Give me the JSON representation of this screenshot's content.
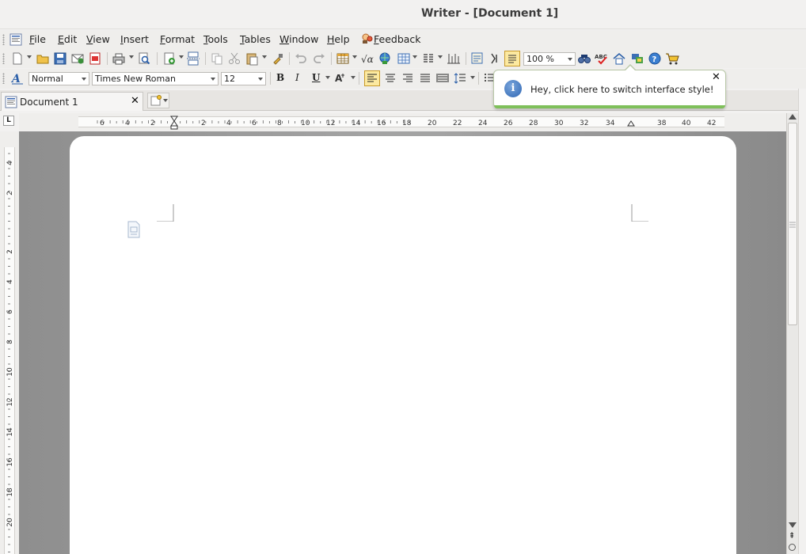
{
  "window": {
    "title": "Writer - [Document 1]"
  },
  "menubar": {
    "items": [
      {
        "label": "File",
        "mnemonic": "F",
        "rest": "ile"
      },
      {
        "label": "Edit",
        "mnemonic": "E",
        "rest": "dit"
      },
      {
        "label": "View",
        "mnemonic": "V",
        "rest": "iew"
      },
      {
        "label": "Insert",
        "mnemonic": "I",
        "rest": "nsert"
      },
      {
        "label": "Format",
        "mnemonic": "F",
        "rest": "ormat"
      },
      {
        "label": "Tools",
        "mnemonic": "T",
        "rest": "ools"
      },
      {
        "label": "Tables",
        "mnemonic": "T",
        "rest": "ables"
      },
      {
        "label": "Window",
        "mnemonic": "W",
        "rest": "indow"
      },
      {
        "label": "Help",
        "mnemonic": "H",
        "rest": "elp"
      }
    ],
    "feedback": {
      "mnemonic": "F",
      "rest": "eedback"
    }
  },
  "format_toolbar": {
    "style": "Normal",
    "font": "Times New Roman",
    "size": "12",
    "bold": "B",
    "italic": "I",
    "underline": "U"
  },
  "standard_toolbar": {
    "zoom": "100 %"
  },
  "tabs": {
    "document": "Document 1"
  },
  "tooltip": {
    "message": "Hey, click here to switch interface style!"
  },
  "hruler": {
    "labels": [
      "6",
      "4",
      "2",
      "2",
      "4",
      "6",
      "8",
      "10",
      "12",
      "14",
      "16",
      "18",
      "20",
      "22",
      "24",
      "26",
      "28",
      "30",
      "32",
      "34",
      "38",
      "40",
      "42"
    ]
  },
  "vruler": {
    "labels": [
      "4",
      "2",
      "2",
      "4",
      "6",
      "8",
      "10",
      "12",
      "14",
      "16",
      "18",
      "20"
    ]
  },
  "colors": {
    "accent_green": "#7fc05a",
    "tooltip_info_blue": "#2f66b3",
    "canvas_gray": "#a3a3a3",
    "page": "#ffffff"
  },
  "icons": {
    "standard_toolbar": [
      "new-document-icon",
      "open-folder-icon",
      "save-icon",
      "email-icon",
      "export-pdf-icon",
      "print-icon",
      "print-preview-icon",
      "insert-object-icon",
      "page-break-icon",
      "copy-icon",
      "cut-icon",
      "paste-icon",
      "format-painter-icon",
      "undo-icon",
      "redo-icon",
      "insert-table-icon",
      "formula-icon",
      "hyperlink-icon",
      "table-grid-icon",
      "columns-icon",
      "tab-stops-icon",
      "navigator-icon",
      "field-icon",
      "outline-icon",
      "find-replace-icon",
      "spellcheck-icon",
      "home-icon",
      "windows-icon",
      "help-icon",
      "shopping-cart-icon"
    ]
  }
}
